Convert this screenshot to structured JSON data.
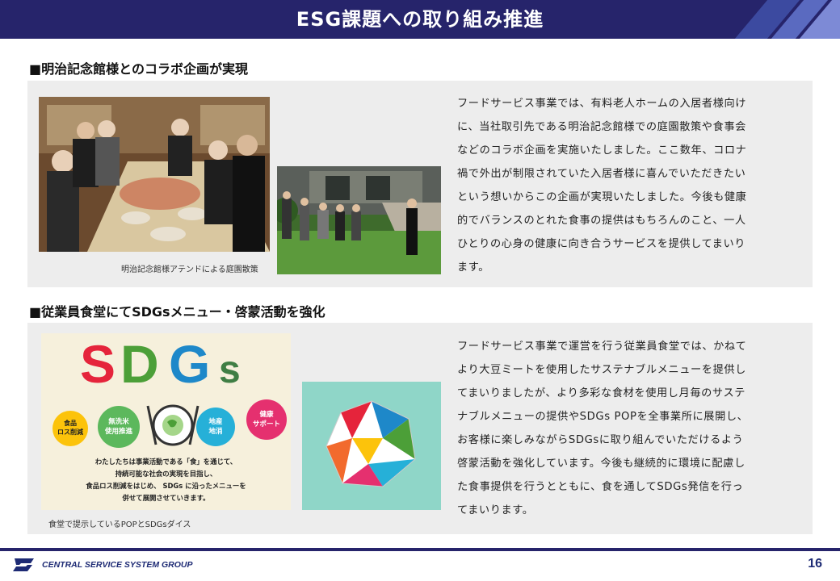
{
  "header": {
    "title": "ESG課題への取り組み推進"
  },
  "section1": {
    "heading": "■明治記念館様とのコラボ企画が実現",
    "photo1_description_icon": "dining-photo",
    "photo2_description_icon": "garden-photo",
    "caption": "明治記念館様アテンドによる庭園散策",
    "body_lines": [
      "フードサービス事業では、有料老人ホームの入居者様向け",
      "に、当社取引先である明治記念館様での庭園散策や食事会",
      "などのコラボ企画を実施いたしました。ここ数年、コロナ",
      "禍で外出が制限されていた入居者様に喜んでいただきたい",
      "という想いからこの企画が実現いたしました。今後も健康",
      "的でバランスのとれた食事の提供はもちろんのこと、一人",
      "ひとりの心身の健康に向き合うサービスを提供してまいり",
      "ます。"
    ]
  },
  "section2": {
    "heading": "■従業員食堂にてSDGsメニュー・啓蒙活動を強化",
    "pop": {
      "logo_letters": [
        "S",
        "D",
        "G",
        "s"
      ],
      "badges": [
        "食品\nロス削減",
        "無洗米\n使用推進",
        "地産\n地消",
        "健康\nサポート"
      ],
      "message_lines": [
        "わたしたちは事業活動である「食」を通じて、",
        "持続可能な社会の実現を目指し、",
        "食品ロス削減をはじめ、 SDGs に沿ったメニューを",
        "併せて展開させていきます。"
      ]
    },
    "caption": "食堂で提示しているPOPとSDGsダイス",
    "body_lines": [
      "フードサービス事業で運営を行う従業員食堂では、かねて",
      "より大豆ミートを使用したサステナブルメニューを提供し",
      "てまいりましたが、より多彩な食材を使用し月毎のサステ",
      "ナブルメニューの提供やSDGs POPを全事業所に展開し、",
      "お客様に楽しみながらSDGsに取り組んでいただけるよう",
      "啓蒙活動を強化しています。今後も継続的に環境に配慮し",
      "た食事提供を行うとともに、食を通してSDGs発信を行っ",
      "てまいります。"
    ]
  },
  "footer": {
    "company": "CENTRAL SERVICE SYSTEM GROUP",
    "page_number": "16"
  },
  "colors": {
    "navy": "#26246b",
    "panel": "#ededed",
    "sdgs_red": "#e5243b",
    "sdgs_green": "#4c9f38",
    "sdgs_blue": "#1e88c9",
    "sdgs_yellow": "#fcc30b"
  }
}
